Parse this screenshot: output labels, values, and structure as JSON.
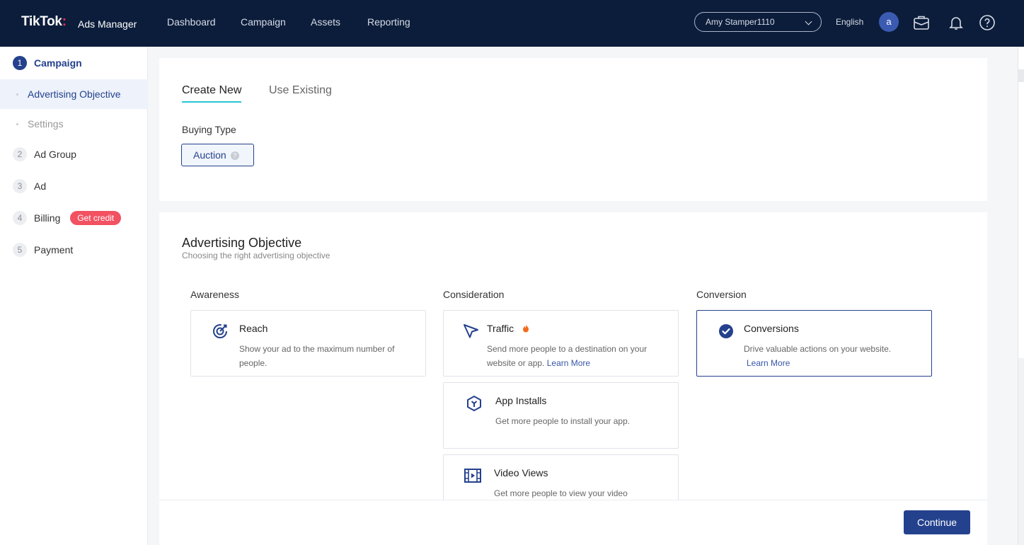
{
  "brand": {
    "logo": "TikTok",
    "logo_dot": ":",
    "product": "Ads Manager"
  },
  "nav": [
    "Dashboard",
    "Campaign",
    "Assets",
    "Reporting"
  ],
  "account": {
    "name": "Amy Stamper1110",
    "language": "English",
    "avatar_letter": "a"
  },
  "sidebar": {
    "steps": [
      {
        "num": "1",
        "label": "Campaign"
      },
      {
        "num": "2",
        "label": "Ad Group"
      },
      {
        "num": "3",
        "label": "Ad"
      },
      {
        "num": "4",
        "label": "Billing"
      },
      {
        "num": "5",
        "label": "Payment"
      }
    ],
    "subitems": [
      "Advertising Objective",
      "Settings"
    ],
    "credit_badge": "Get credit"
  },
  "tabs": {
    "create_new": "Create New",
    "use_existing": "Use Existing"
  },
  "buying": {
    "label": "Buying Type",
    "value": "Auction",
    "help": "?"
  },
  "objective": {
    "title": "Advertising Objective",
    "subtitle": "Choosing the right advertising objective",
    "columns": [
      "Awareness",
      "Consideration",
      "Conversion"
    ],
    "reach": {
      "name": "Reach",
      "desc": "Show your ad to the maximum number of people."
    },
    "traffic": {
      "name": "Traffic",
      "desc": "Send more people to a destination on your website or app.",
      "learn": "Learn More"
    },
    "app_installs": {
      "name": "App Installs",
      "desc": "Get more people to install your app."
    },
    "video_views": {
      "name": "Video Views",
      "desc": "Get more people to view your video"
    },
    "conversions": {
      "name": "Conversions",
      "desc": "Drive valuable actions on your website.",
      "learn": "Learn More"
    }
  },
  "footer": {
    "continue_label": "Continue"
  },
  "colors": {
    "primary": "#24418d",
    "topbar": "#0c1d3b",
    "tab_underline": "#25c4d4",
    "badge": "#f25162"
  }
}
